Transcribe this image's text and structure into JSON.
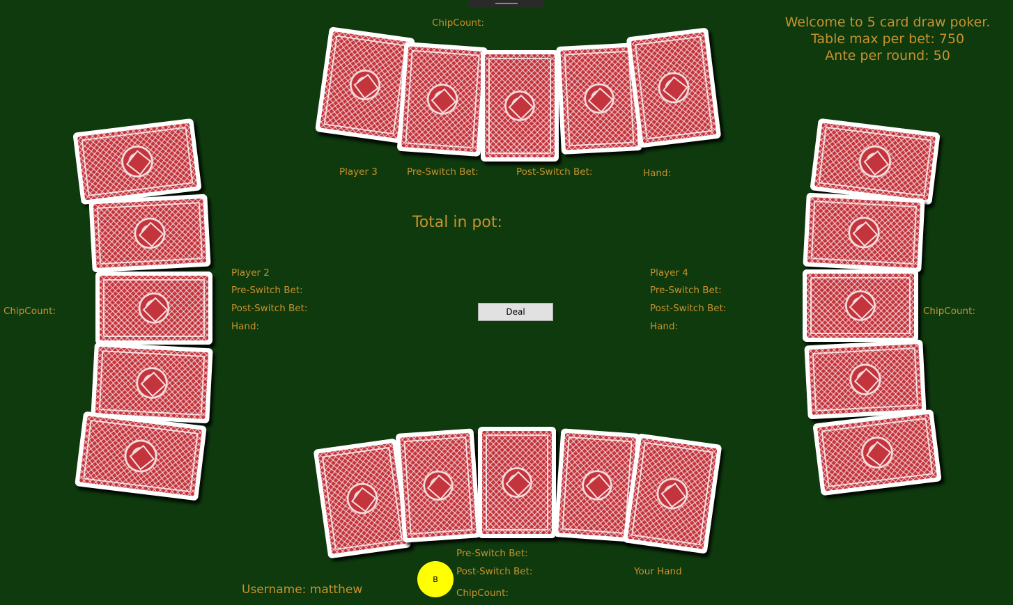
{
  "window": {
    "drag_handle_icon": "grip-lines-icon"
  },
  "welcome": {
    "line1": "Welcome to 5 card draw poker.",
    "line2": "Table max per bet: 750",
    "line3": "Ante per round: 50"
  },
  "pot": {
    "label": "Total in pot:"
  },
  "deal_button": {
    "label": "Deal"
  },
  "player3": {
    "chipcount": "ChipCount:",
    "name": "Player 3",
    "pre_switch": "Pre-Switch Bet:",
    "post_switch": "Post-Switch Bet:",
    "hand": "Hand:"
  },
  "player2": {
    "chipcount": "ChipCount:",
    "name": "Player 2",
    "pre_switch": "Pre-Switch Bet:",
    "post_switch": "Post-Switch Bet:",
    "hand": "Hand:"
  },
  "player4": {
    "chipcount": "ChipCount:",
    "name": "Player 4",
    "pre_switch": "Pre-Switch Bet:",
    "post_switch": "Post-Switch Bet:",
    "hand": "Hand:"
  },
  "me": {
    "pre_switch": "Pre-Switch Bet:",
    "post_switch": "Post-Switch Bet:",
    "chipcount": "ChipCount:",
    "hand": "Your Hand",
    "username": "Username: matthew",
    "dealer_chip": "B"
  },
  "card_back": {
    "face": "face-down",
    "color": "#c4343c"
  },
  "colors": {
    "table": "#0e3a0e",
    "text": "#c8922e",
    "dealer_chip": "#ffff00"
  }
}
